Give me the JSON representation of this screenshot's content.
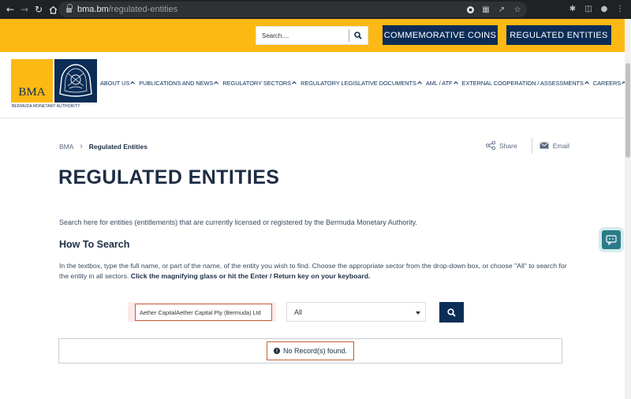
{
  "browser": {
    "url_host": "bma.bm",
    "url_path": "/regulated-entities"
  },
  "topbar": {
    "search_placeholder": "Search....",
    "commemorative_label": "COMMEMORATIVE COINS",
    "regulated_label": "REGULATED ENTITIES"
  },
  "logo": {
    "abbr": "BMA",
    "full_name": "BERMUDA MONETARY AUTHORITY"
  },
  "nav": {
    "items": [
      {
        "label": "ABOUT US"
      },
      {
        "label": "PUBLICATIONS AND NEWS"
      },
      {
        "label": "REGULATORY SECTORS"
      },
      {
        "label": "REGULATORY LEGISLATIVE DOCUMENTS"
      },
      {
        "label": "AML / ATF"
      },
      {
        "label": "EXTERNAL COOPERATION / ASSESSMENTS"
      },
      {
        "label": "CAREERS"
      }
    ]
  },
  "breadcrumb": {
    "home": "BMA",
    "current": "Regulated Entities"
  },
  "share": {
    "share_label": "Share",
    "email_label": "Email"
  },
  "page": {
    "title": "REGULATED ENTITIES",
    "intro": "Search here for entities (entitlements) that are currently licensed or registered by the Bermuda Monetary Authority.",
    "how_title": "How To Search",
    "how_text": "In the textbox, type the full name, or part of the name, of the entity you wish to find. Choose the appropriate sector from the drop-down box, or choose \"All\" to search for the entity in all sectors.",
    "how_text_bold": "Click the magnifying glass or hit the Enter / Return key on your keyboard."
  },
  "search_form": {
    "entity_value": "Aether CapitalAether Capital Pty (Bermuda) Ltd",
    "sector_value": "All"
  },
  "result": {
    "message": "No Record(s) found."
  },
  "colors": {
    "brand_yellow": "#fdb913",
    "brand_navy": "#0b2d56",
    "highlight": "#c0613a"
  }
}
